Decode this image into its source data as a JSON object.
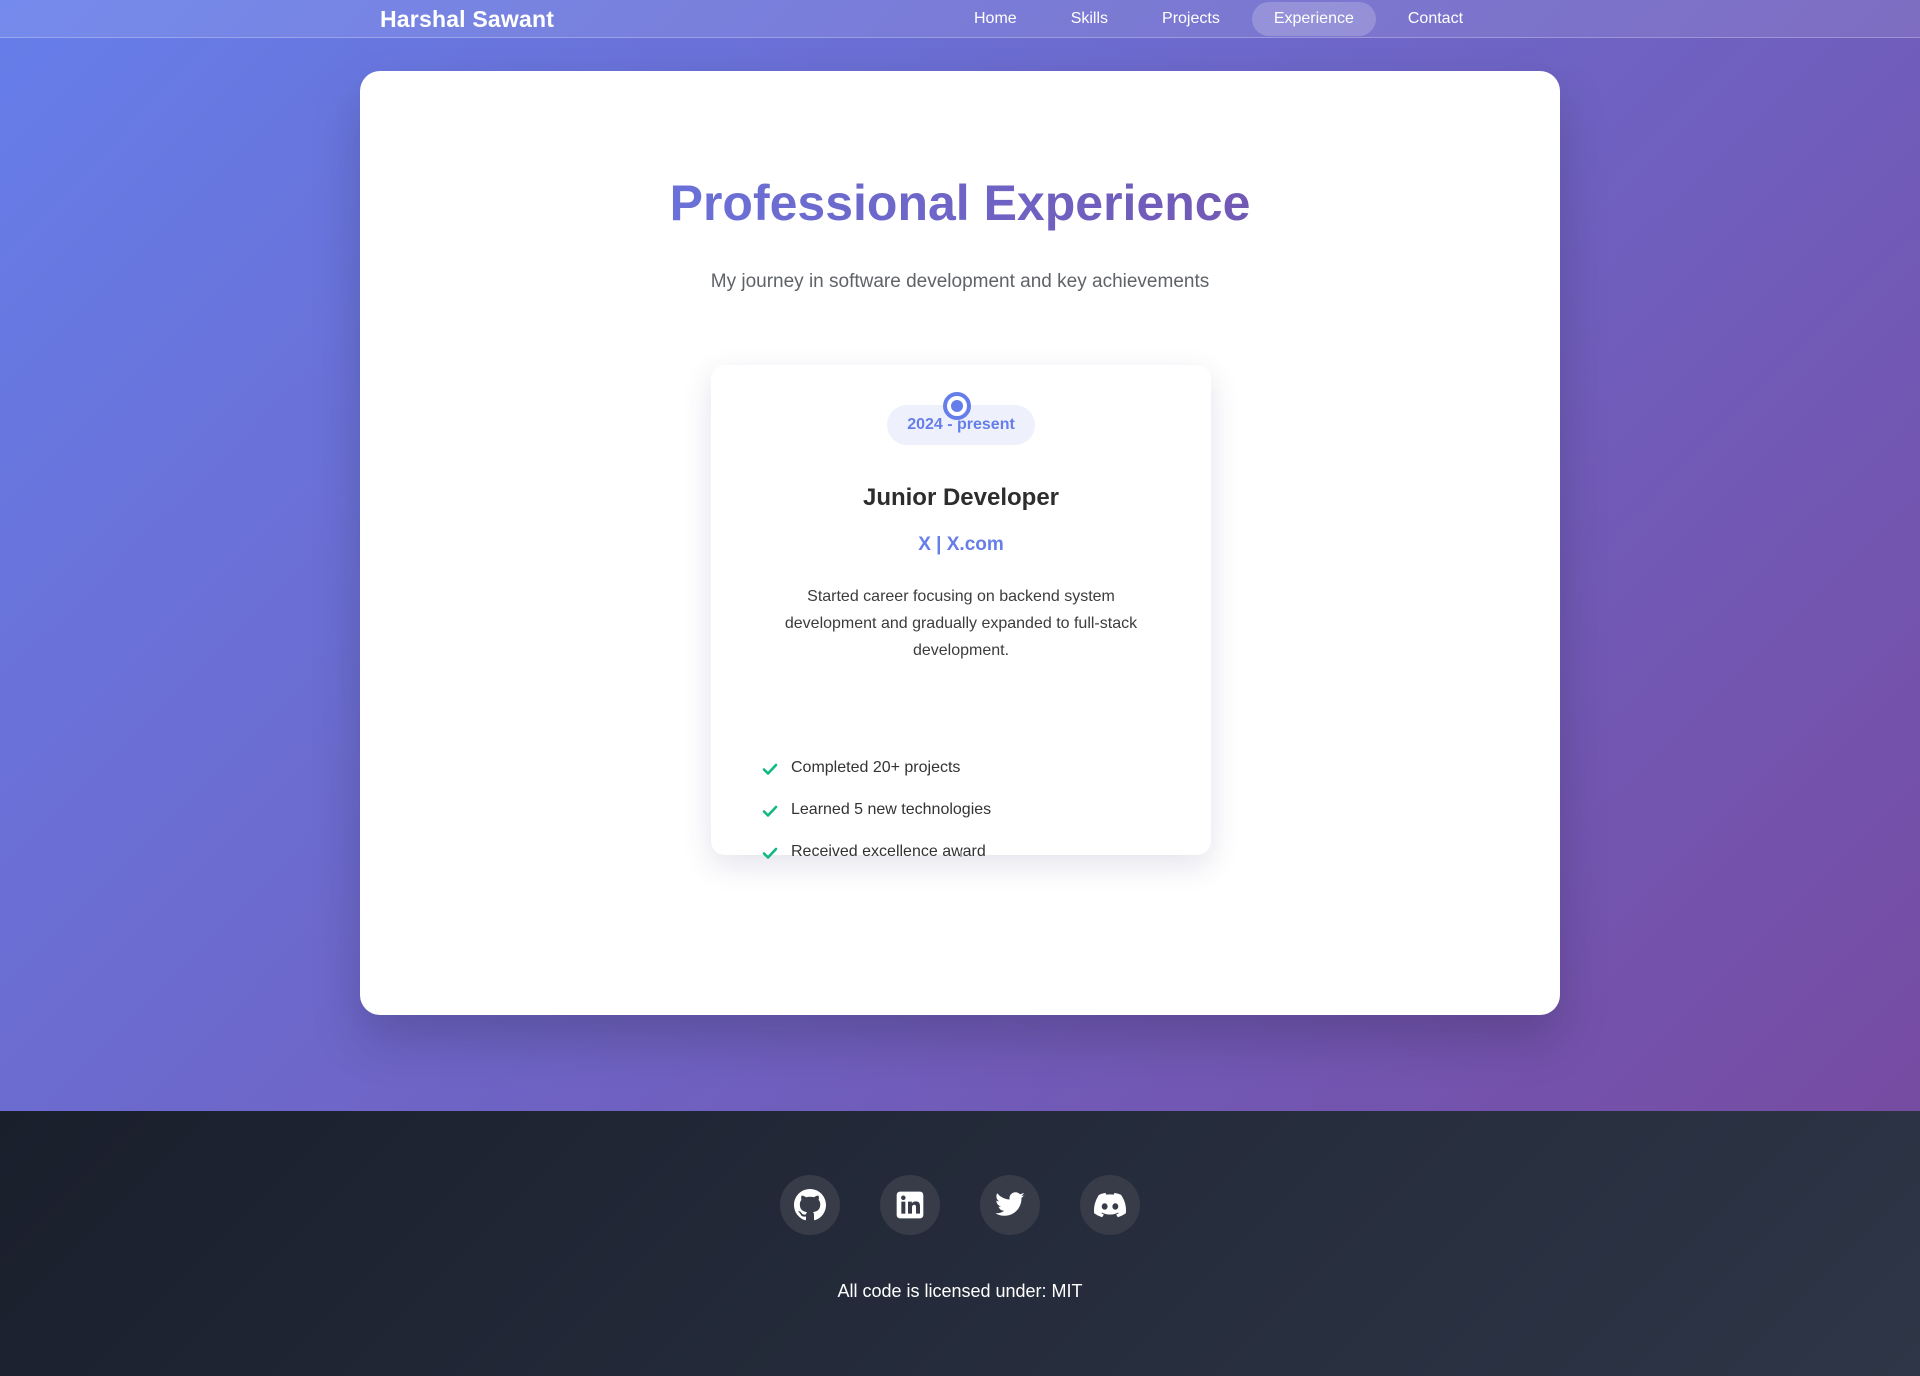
{
  "nav": {
    "brand": "Harshal Sawant",
    "links": [
      {
        "label": "Home",
        "active": false
      },
      {
        "label": "Skills",
        "active": false
      },
      {
        "label": "Projects",
        "active": false
      },
      {
        "label": "Experience",
        "active": true
      },
      {
        "label": "Contact",
        "active": false
      }
    ]
  },
  "section": {
    "title": "Professional Experience",
    "subtitle": "My journey in software development and key achievements"
  },
  "experience": {
    "date": "2024 - present",
    "title": "Junior Developer",
    "company": "X | X.com",
    "description": "Started career focusing on backend system development and gradually expanded to full-stack development.",
    "achievements": [
      "Completed 20+ projects",
      "Learned 5 new technologies",
      "Received excellence award"
    ]
  },
  "footer": {
    "social": [
      "github-icon",
      "linkedin-icon",
      "twitter-icon",
      "discord-icon"
    ],
    "license": "All code is licensed under: MIT"
  },
  "colors": {
    "gradient_start": "#667eea",
    "gradient_end": "#764ba2",
    "accent": "#667eea",
    "check": "#10b981",
    "footer_bg": "#1a1f2c"
  }
}
